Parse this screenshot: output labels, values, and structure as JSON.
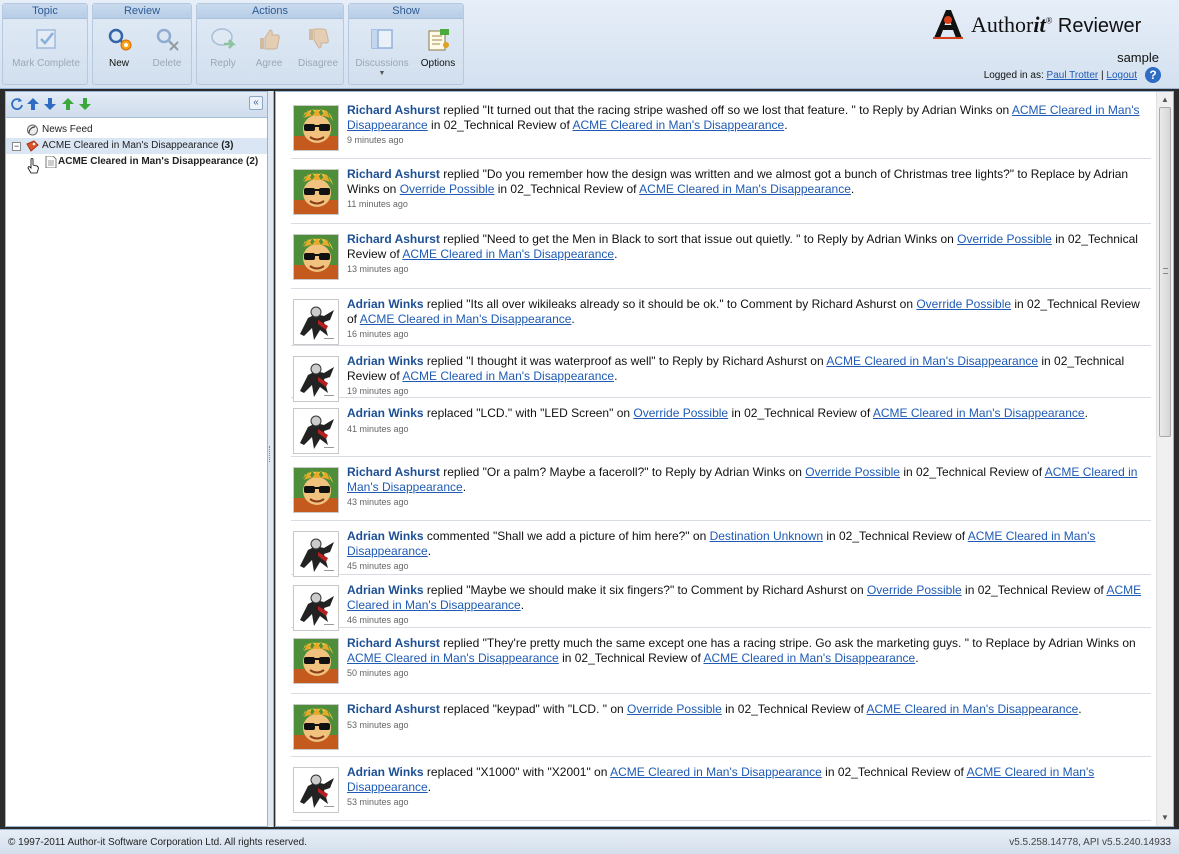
{
  "toolbar": {
    "groups": [
      {
        "title": "Topic"
      },
      {
        "title": "Review"
      },
      {
        "title": "Actions"
      },
      {
        "title": "Show"
      }
    ],
    "buttons": {
      "mark_complete": "Mark Complete",
      "new": "New",
      "delete": "Delete",
      "reply": "Reply",
      "agree": "Agree",
      "disagree": "Disagree",
      "discussions": "Discussions",
      "options": "Options"
    }
  },
  "brand": {
    "name_prefix": "Author",
    "name_it": "it",
    "registered": "®",
    "name_suffix": "Reviewer",
    "site": "sample"
  },
  "user": {
    "logged_in_label": "Logged in as:",
    "name": "Paul Trotter",
    "separator": "|",
    "logout": "Logout",
    "help": "?"
  },
  "tree": {
    "collapse": "«",
    "items": [
      {
        "label": "News Feed"
      },
      {
        "label": "ACME Cleared in Man's Disappearance",
        "count": "(3)"
      },
      {
        "label": "ACME Cleared in Man's Disappearance",
        "count": "(2)"
      }
    ]
  },
  "feed": [
    {
      "author": "Richard Ashurst",
      "action": " replied \"It turned out that the racing stripe washed off so we lost that feature. \" to Reply by Adrian Winks on ",
      "target": "ACME Cleared in Man's Disappearance",
      "mid": " in 02_Technical Review of ",
      "doc": "ACME Cleared in Man's Disappearance",
      "end": ".",
      "time": "9 minutes ago",
      "avatar": "richard"
    },
    {
      "author": "Richard Ashurst",
      "action": " replied \"Do you remember how the design was written and we almost got a bunch of Christmas tree lights?\" to Replace by Adrian Winks on ",
      "target": "Override Possible",
      "mid": " in 02_Technical Review of ",
      "doc": "ACME Cleared in Man's Disappearance",
      "end": ".",
      "time": "11 minutes ago",
      "avatar": "richard"
    },
    {
      "author": "Richard Ashurst",
      "action": " replied \"Need to get the Men in Black to sort that issue out quietly. \" to Reply by Adrian Winks on ",
      "target": "Override Possible",
      "mid": " in 02_Technical Review of ",
      "doc": "ACME Cleared in Man's Disappearance",
      "end": ".",
      "time": "13 minutes ago",
      "avatar": "richard"
    },
    {
      "author": "Adrian Winks",
      "action": " replied \"Its all over wikileaks already so it should be ok.\" to Comment by Richard Ashurst on ",
      "target": "Override Possible",
      "mid": " in 02_Technical Review of ",
      "doc": "ACME Cleared in Man's Disappearance",
      "end": ".",
      "time": "16 minutes ago",
      "avatar": "adrian"
    },
    {
      "author": "Adrian Winks",
      "action": " replied \"I thought it was waterproof as well\" to Reply by Richard Ashurst on ",
      "target": "ACME Cleared in Man's Disappearance",
      "mid": " in 02_Technical Review of ",
      "doc": "ACME Cleared in Man's Disappearance",
      "end": ".",
      "time": "19 minutes ago",
      "avatar": "adrian"
    },
    {
      "author": "Adrian Winks",
      "action": " replaced \"LCD.\" with \"LED Screen\" on ",
      "target": "Override Possible",
      "mid": " in 02_Technical Review of ",
      "doc": "ACME Cleared in Man's Disappearance",
      "end": ".",
      "time": "41 minutes ago",
      "avatar": "adrian"
    },
    {
      "author": "Richard Ashurst",
      "action": " replied \"Or a palm? Maybe a faceroll?\" to Reply by Adrian Winks on ",
      "target": "Override Possible",
      "mid": " in 02_Technical Review of ",
      "doc": "ACME Cleared in Man's Disappearance",
      "end": ".",
      "time": "43 minutes ago",
      "avatar": "richard"
    },
    {
      "author": "Adrian Winks",
      "action": " commented \"Shall we add a picture of him here?\" on ",
      "target": "Destination Unknown",
      "mid": " in 02_Technical Review of ",
      "doc": "ACME Cleared in Man's Disappearance",
      "end": ".",
      "time": "45 minutes ago",
      "avatar": "adrian"
    },
    {
      "author": "Adrian Winks",
      "action": " replied \"Maybe we should make it six fingers?\" to Comment by Richard Ashurst on ",
      "target": "Override Possible",
      "mid": " in 02_Technical Review of ",
      "doc": "ACME Cleared in Man's Disappearance",
      "end": ".",
      "time": "46 minutes ago",
      "avatar": "adrian"
    },
    {
      "author": "Richard Ashurst",
      "action": " replied \"They're pretty much the same except one has a racing stripe. Go ask the marketing guys. \" to Replace by Adrian Winks on ",
      "target": "ACME Cleared in Man's Disappearance",
      "mid": " in 02_Technical Review of ",
      "doc": "ACME Cleared in Man's Disappearance",
      "end": ".",
      "time": "50 minutes ago",
      "avatar": "richard"
    },
    {
      "author": "Richard Ashurst",
      "action": " replaced \"keypad\" with \"LCD. \" on ",
      "target": "Override Possible",
      "mid": " in 02_Technical Review of ",
      "doc": "ACME Cleared in Man's Disappearance",
      "end": ".",
      "time": "53 minutes ago",
      "avatar": "richard"
    },
    {
      "author": "Adrian Winks",
      "action": " replaced \"X1000\" with \"X2001\" on ",
      "target": "ACME Cleared in Man's Disappearance",
      "mid": " in 02_Technical Review of ",
      "doc": "ACME Cleared in Man's Disappearance",
      "end": ".",
      "time": "53 minutes ago",
      "avatar": "adrian"
    }
  ],
  "status": {
    "copyright": "© 1997-2011 Author-it Software Corporation Ltd. All rights reserved.",
    "version": "v5.5.258.14778, API v5.5.240.14933"
  },
  "colors": {
    "accent": "#1d4f95",
    "link": "#1f5bb5",
    "toolbar_bg": "#d4e1f0"
  }
}
